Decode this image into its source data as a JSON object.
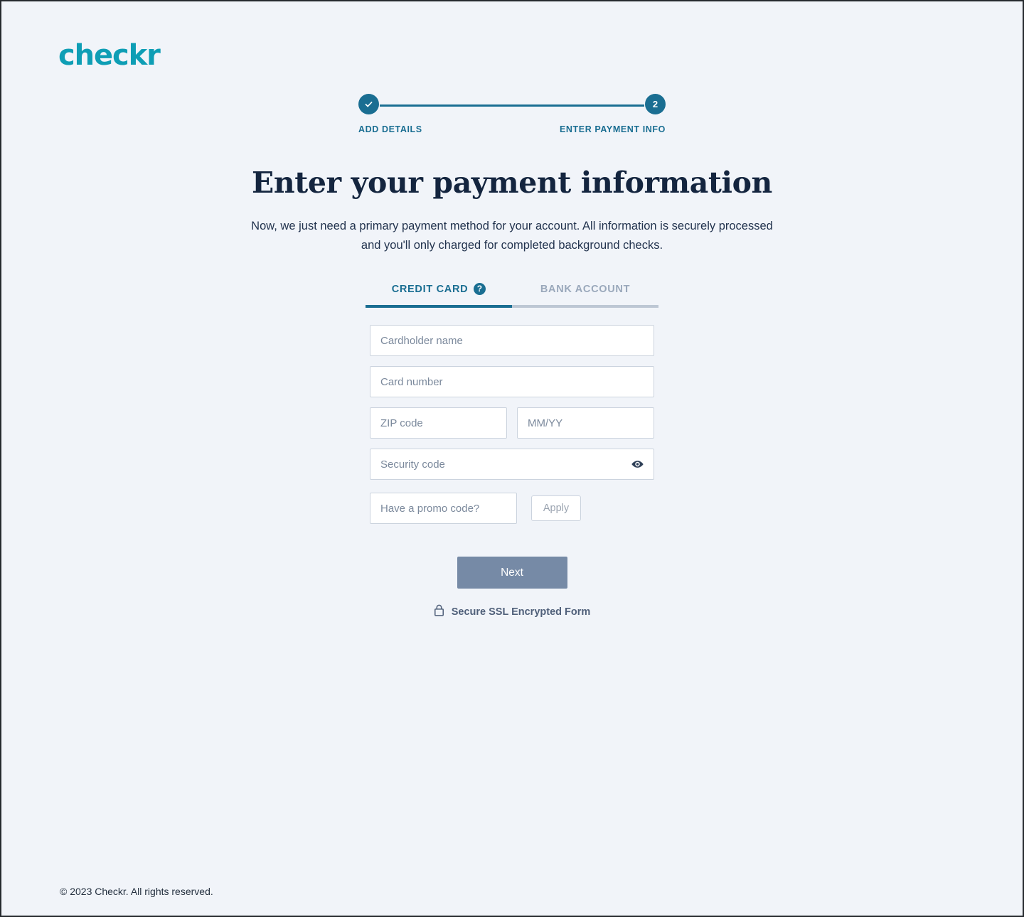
{
  "brand": {
    "logo_text": "checkr",
    "logo_color": "#0e9eb5"
  },
  "stepper": {
    "accent_color": "#1a6e92",
    "steps": [
      {
        "marker": "✓",
        "label": "ADD DETAILS",
        "state": "completed"
      },
      {
        "marker": "2",
        "label": "ENTER PAYMENT INFO",
        "state": "active"
      }
    ]
  },
  "main": {
    "heading": "Enter your payment information",
    "subheading": "Now, we just need a primary payment method for your account. All information is securely processed and you'll only charged for completed background checks."
  },
  "tabs": [
    {
      "label": "CREDIT CARD",
      "active": true,
      "help_icon": "?"
    },
    {
      "label": "BANK ACCOUNT",
      "active": false
    }
  ],
  "form": {
    "cardholder_name": {
      "placeholder": "Cardholder name",
      "value": ""
    },
    "card_number": {
      "placeholder": "Card number",
      "value": ""
    },
    "zip_code": {
      "placeholder": "ZIP code",
      "value": ""
    },
    "expiry": {
      "placeholder": "MM/YY",
      "value": ""
    },
    "security_code": {
      "placeholder": "Security code",
      "value": "",
      "icon": "eye-icon"
    },
    "promo_code": {
      "placeholder": "Have a promo code?",
      "value": ""
    },
    "apply_label": "Apply",
    "submit_label": "Next",
    "submit_color": "#768aa6"
  },
  "security_note": {
    "icon": "lock-icon",
    "text": "Secure SSL Encrypted Form"
  },
  "footer": {
    "copyright": "© 2023 Checkr. All rights reserved."
  }
}
